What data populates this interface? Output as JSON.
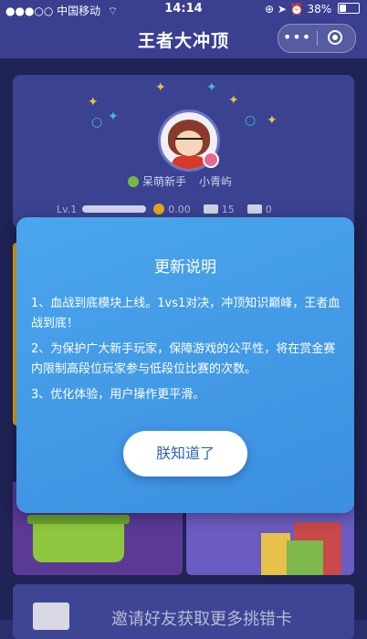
{
  "status_bar": {
    "carrier": "●●●○○ 中国移动",
    "wifi_icon": "wifi-icon",
    "time": "14:14",
    "battery_text": "38%",
    "battery_level": 0.38
  },
  "nav": {
    "title": "王者大冲顶",
    "more_label": "•••",
    "close_icon": "record-icon"
  },
  "profile": {
    "rank": "呆萌新手",
    "nickname": "小青屿",
    "level": "Lv.1",
    "coins": "0.00",
    "cards_a": "15",
    "cards_b": "0"
  },
  "invite": {
    "text": "邀请好友获取更多挑错卡"
  },
  "modal": {
    "title": "更新说明",
    "items": [
      "1、血战到底模块上线。1vs1对决，冲顶知识巅峰，王者血战到底！",
      "2、为保护广大新手玩家，保障游戏的公平性，将在赏金赛内限制高段位玩家参与低段位比赛的次数。",
      "3、优化体验，用户操作更平滑。"
    ],
    "confirm_label": "朕知道了"
  },
  "colors": {
    "nav_bg": "#3a3f8f",
    "modal_bg": "#4aa6ec",
    "button_text": "#2f63b6"
  }
}
